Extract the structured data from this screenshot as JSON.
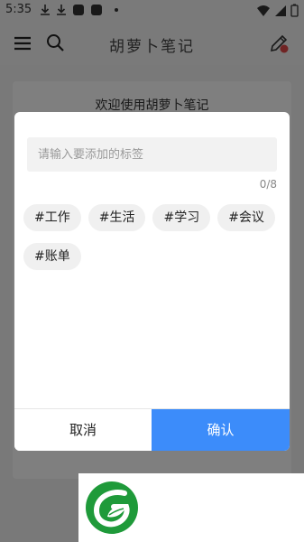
{
  "status": {
    "time": "5:35",
    "icons": [
      "download-icon",
      "download-icon",
      "app-icon",
      "app-icon",
      "dot-icon",
      "wifi-icon",
      "signal-icon",
      "battery-icon"
    ]
  },
  "app_bar": {
    "title": "胡萝卜笔记",
    "icons": [
      "menu-icon",
      "search-icon",
      "edit-icon"
    ]
  },
  "note": {
    "text": "欢迎使用胡萝卜笔记"
  },
  "dialog": {
    "input_placeholder": "请输入要添加的标签",
    "input_value": "",
    "counter": "0/8",
    "tags": [
      {
        "label": "#工作"
      },
      {
        "label": "#生活"
      },
      {
        "label": "#学习"
      },
      {
        "label": "#会议"
      },
      {
        "label": "#账单"
      }
    ],
    "cancel_label": "取消",
    "confirm_label": "确认"
  },
  "colors": {
    "accent": "#3c8cfa",
    "logo_green": "#1f9a3a"
  }
}
